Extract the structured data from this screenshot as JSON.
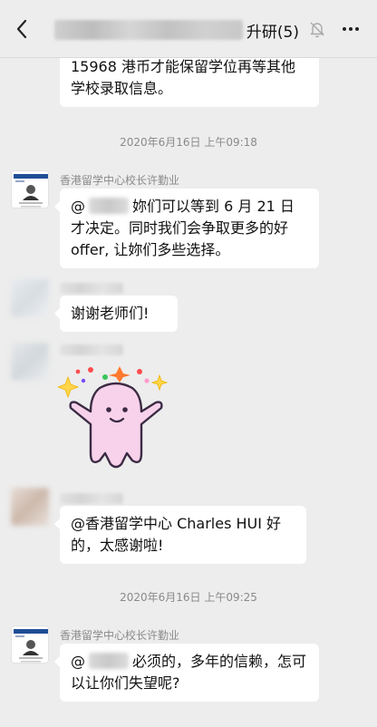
{
  "header": {
    "title_suffix": "升研(5)",
    "back_icon": "back-chevron-icon",
    "mute_icon": "bell-muted-icon",
    "more_icon": "more-dots-icon"
  },
  "messages": [
    {
      "text": "15968 港币才能保留学位再等其他学校录取信息。"
    },
    {
      "timestamp": "2020年6月16日 上午09:18"
    },
    {
      "sender": "香港留学中心校长许勤业",
      "prefix": "@",
      "text": "妳们可以等到 6 月 21 日才决定。同时我们会争取更多的好 offer, 让妳们多些选择。"
    },
    {
      "text": "谢谢老师们!"
    },
    {
      "sticker": "pink-ghost-sticker"
    },
    {
      "text": "@香港留学中心 Charles HUI 好的，太感谢啦!"
    },
    {
      "timestamp": "2020年6月16日 上午09:25"
    },
    {
      "sender": "香港留学中心校长许勤业",
      "prefix": "@",
      "text": "必须的，多年的信赖，怎可以让你们失望呢?"
    }
  ],
  "colors": {
    "background": "#ededed",
    "bubble": "#ffffff",
    "meta_text": "#8a8a8a"
  }
}
